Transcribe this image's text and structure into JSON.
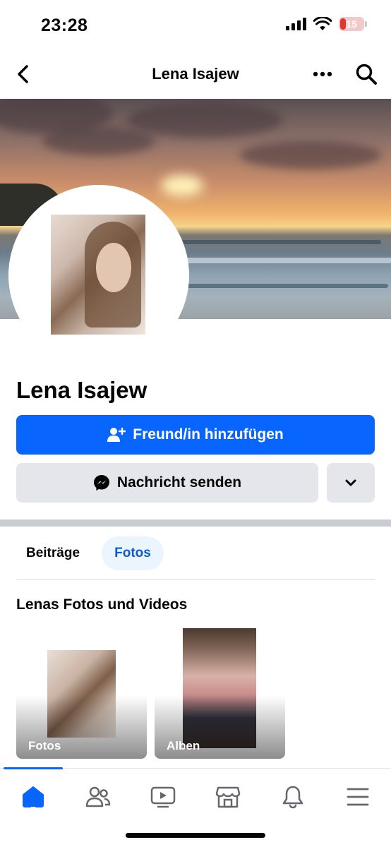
{
  "status_bar": {
    "time": "23:28",
    "battery": "15"
  },
  "nav": {
    "title": "Lena Isajew"
  },
  "profile": {
    "name": "Lena Isajew",
    "add_friend_label": "Freund/in hinzufügen",
    "message_label": "Nachricht senden"
  },
  "tabs": [
    {
      "label": "Beiträge",
      "active": false
    },
    {
      "label": "Fotos",
      "active": true
    }
  ],
  "media": {
    "title": "Lenas Fotos und Videos",
    "tiles": [
      {
        "label": "Fotos"
      },
      {
        "label": "Alben"
      }
    ]
  },
  "bottom_nav": [
    {
      "icon": "home-icon",
      "active": true
    },
    {
      "icon": "friends-icon",
      "active": false
    },
    {
      "icon": "video-icon",
      "active": false
    },
    {
      "icon": "marketplace-icon",
      "active": false
    },
    {
      "icon": "bell-icon",
      "active": false
    },
    {
      "icon": "menu-icon",
      "active": false
    }
  ],
  "colors": {
    "accent": "#0866ff",
    "button_gray": "#e4e6eb",
    "tab_active_bg": "#ebf5ff",
    "battery_low": "#e0342f"
  }
}
